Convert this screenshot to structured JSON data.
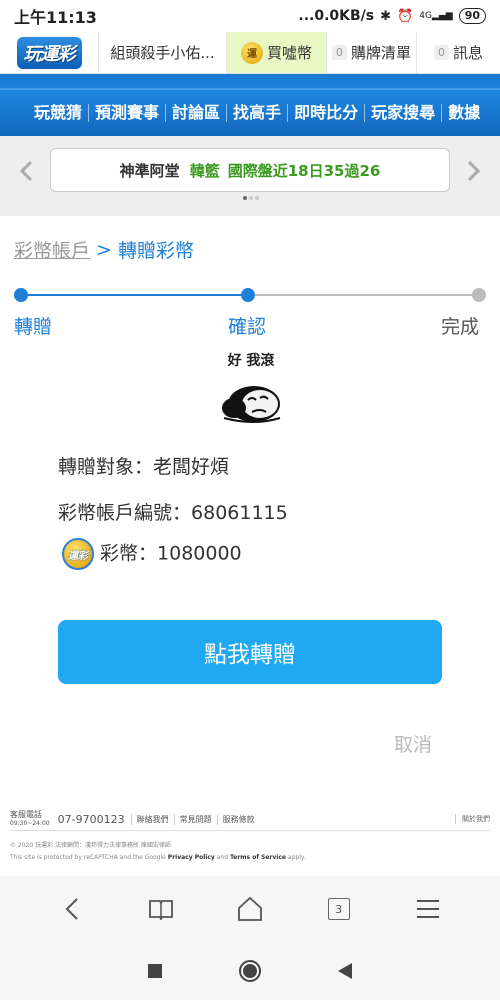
{
  "status_bar": {
    "time": "上午11:13",
    "network_speed": "...0.0KB/s",
    "signal_label": "4G",
    "battery": "90"
  },
  "header": {
    "logo": "玩運彩",
    "username": "組頭殺手小佑...",
    "coin_icon_text": "運",
    "buy_coins": "買噓幣",
    "cart_count": "0",
    "cart_label": "購牌清單",
    "message_count": "0",
    "message_label": "訊息"
  },
  "nav": {
    "items": [
      "玩競猜",
      "預測賽事",
      "討論區",
      "找高手",
      "即時比分",
      "玩家搜尋",
      "數據"
    ]
  },
  "ticker": {
    "part1": "神準阿堂",
    "part2": "韓籃",
    "part3": "國際盤近18日35過26"
  },
  "breadcrumb": {
    "parent": "彩幣帳戶",
    "separator": ">",
    "current": "轉贈彩幣"
  },
  "steps": {
    "step1": "轉贈",
    "step2": "確認",
    "step3": "完成",
    "active_color": "#1e7fd8",
    "inactive_color": "#bbbbbb"
  },
  "sticker": {
    "caption": "好 我滾"
  },
  "transfer_info": {
    "recipient_label": "轉贈對象：",
    "recipient_value": "老闆好煩",
    "account_label": "彩幣帳戶編號：",
    "account_value": "68061115",
    "coin_label": "彩幣：",
    "coin_value": "1080000",
    "coin_logo_text": "運彩"
  },
  "actions": {
    "transfer_button": "點我轉贈",
    "cancel": "取消"
  },
  "footer": {
    "service_label_1": "客服電話",
    "service_label_2": "09:30~24:00",
    "phone": "07-9700123",
    "links": [
      "聯絡我們",
      "常見問題",
      "服務條款"
    ],
    "right_link": "關於我們",
    "copyright": "© 2020 玩運彩 法律顧問：漢邦得力法律事務所 陳國宏律師",
    "recaptcha_prefix": "This site is protected by reCAPTCHA and the Google",
    "privacy": "Privacy Policy",
    "and": "and",
    "terms": "Terms of Service",
    "apply": "apply."
  },
  "browser": {
    "tab_count": "3"
  }
}
